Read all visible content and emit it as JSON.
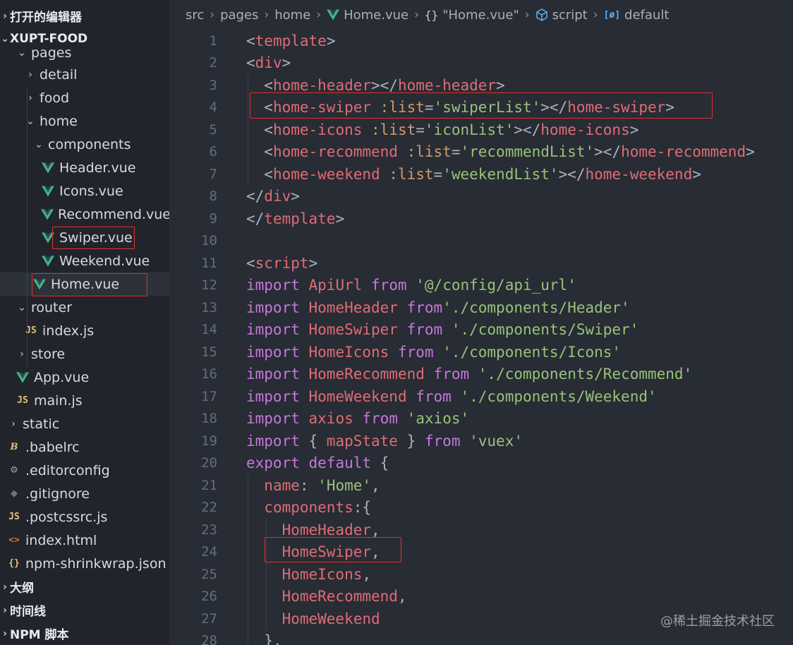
{
  "sidebar": {
    "open_editors_label": "打开的编辑器",
    "project_label": "XUPT-FOOD",
    "tree": [
      {
        "label": "pages",
        "type": "folder",
        "open": true
      },
      {
        "label": "detail",
        "type": "folder",
        "open": false
      },
      {
        "label": "food",
        "type": "folder",
        "open": false
      },
      {
        "label": "home",
        "type": "folder",
        "open": true
      },
      {
        "label": "components",
        "type": "folder",
        "open": true
      },
      {
        "label": "Header.vue",
        "type": "vue"
      },
      {
        "label": "Icons.vue",
        "type": "vue"
      },
      {
        "label": "Recommend.vue",
        "type": "vue"
      },
      {
        "label": "Swiper.vue",
        "type": "vue"
      },
      {
        "label": "Weekend.vue",
        "type": "vue"
      },
      {
        "label": "Home.vue",
        "type": "vue",
        "selected": true
      },
      {
        "label": "router",
        "type": "folder",
        "open": true
      },
      {
        "label": "index.js",
        "type": "js"
      },
      {
        "label": "store",
        "type": "folder",
        "open": false
      },
      {
        "label": "App.vue",
        "type": "vue"
      },
      {
        "label": "main.js",
        "type": "js"
      },
      {
        "label": "static",
        "type": "folder",
        "open": false
      },
      {
        "label": ".babelrc",
        "type": "babel"
      },
      {
        "label": ".editorconfig",
        "type": "config"
      },
      {
        "label": ".gitignore",
        "type": "git"
      },
      {
        "label": ".postcssrc.js",
        "type": "js"
      },
      {
        "label": "index.html",
        "type": "html"
      },
      {
        "label": "npm-shrinkwrap.json",
        "type": "json"
      }
    ],
    "outline_label": "大纲",
    "timeline_label": "时间线",
    "npm_scripts_label": "NPM 脚本"
  },
  "breadcrumb": {
    "items": [
      "src",
      "pages",
      "home",
      "Home.vue",
      "\"Home.vue\"",
      "script",
      "default"
    ]
  },
  "editor": {
    "lines": [
      {
        "n": "1",
        "tokens": [
          [
            "p",
            "<"
          ],
          [
            "tag",
            "template"
          ],
          [
            "p",
            ">"
          ]
        ]
      },
      {
        "n": "2",
        "tokens": [
          [
            "p",
            "<"
          ],
          [
            "tag",
            "div"
          ],
          [
            "p",
            ">"
          ]
        ]
      },
      {
        "n": "3",
        "tokens": [
          [
            "p",
            "  <"
          ],
          [
            "tag",
            "home-header"
          ],
          [
            "p",
            "></"
          ],
          [
            "tag",
            "home-header"
          ],
          [
            "p",
            ">"
          ]
        ]
      },
      {
        "n": "4",
        "tokens": [
          [
            "p",
            "  <"
          ],
          [
            "tag",
            "home-swiper"
          ],
          [
            "p",
            " "
          ],
          [
            "attr",
            ":list"
          ],
          [
            "p",
            "="
          ],
          [
            "str",
            "'swiperList'"
          ],
          [
            "p",
            "></"
          ],
          [
            "tag",
            "home-swiper"
          ],
          [
            "p",
            ">"
          ]
        ]
      },
      {
        "n": "5",
        "tokens": [
          [
            "p",
            "  <"
          ],
          [
            "tag",
            "home-icons"
          ],
          [
            "p",
            " "
          ],
          [
            "attr",
            ":list"
          ],
          [
            "p",
            "="
          ],
          [
            "str",
            "'iconList'"
          ],
          [
            "p",
            "></"
          ],
          [
            "tag",
            "home-icons"
          ],
          [
            "p",
            ">"
          ]
        ]
      },
      {
        "n": "6",
        "tokens": [
          [
            "p",
            "  <"
          ],
          [
            "tag",
            "home-recommend"
          ],
          [
            "p",
            " "
          ],
          [
            "attr",
            ":list"
          ],
          [
            "p",
            "="
          ],
          [
            "str",
            "'recommendList'"
          ],
          [
            "p",
            "></"
          ],
          [
            "tag",
            "home-recommend"
          ],
          [
            "p",
            ">"
          ]
        ]
      },
      {
        "n": "7",
        "tokens": [
          [
            "p",
            "  <"
          ],
          [
            "tag",
            "home-weekend"
          ],
          [
            "p",
            " "
          ],
          [
            "attr",
            ":list"
          ],
          [
            "p",
            "="
          ],
          [
            "str",
            "'weekendList'"
          ],
          [
            "p",
            "></"
          ],
          [
            "tag",
            "home-weekend"
          ],
          [
            "p",
            ">"
          ]
        ]
      },
      {
        "n": "8",
        "tokens": [
          [
            "p",
            "</"
          ],
          [
            "tag",
            "div"
          ],
          [
            "p",
            ">"
          ]
        ]
      },
      {
        "n": "9",
        "tokens": [
          [
            "p",
            "</"
          ],
          [
            "tag",
            "template"
          ],
          [
            "p",
            ">"
          ]
        ]
      },
      {
        "n": "10",
        "tokens": []
      },
      {
        "n": "11",
        "tokens": [
          [
            "p",
            "<"
          ],
          [
            "tag",
            "script"
          ],
          [
            "p",
            ">"
          ]
        ]
      },
      {
        "n": "12",
        "tokens": [
          [
            "kw",
            "import"
          ],
          [
            "p",
            " "
          ],
          [
            "id",
            "ApiUrl"
          ],
          [
            "p",
            " "
          ],
          [
            "kw",
            "from"
          ],
          [
            "p",
            " "
          ],
          [
            "str",
            "'@/config/api_url'"
          ]
        ]
      },
      {
        "n": "13",
        "tokens": [
          [
            "kw",
            "import"
          ],
          [
            "p",
            " "
          ],
          [
            "id",
            "HomeHeader"
          ],
          [
            "p",
            " "
          ],
          [
            "kw",
            "from"
          ],
          [
            "str",
            "'./components/Header'"
          ]
        ]
      },
      {
        "n": "14",
        "tokens": [
          [
            "kw",
            "import"
          ],
          [
            "p",
            " "
          ],
          [
            "id",
            "HomeSwiper"
          ],
          [
            "p",
            " "
          ],
          [
            "kw",
            "from"
          ],
          [
            "p",
            " "
          ],
          [
            "str",
            "'./components/Swiper'"
          ]
        ]
      },
      {
        "n": "15",
        "tokens": [
          [
            "kw",
            "import"
          ],
          [
            "p",
            " "
          ],
          [
            "id",
            "HomeIcons"
          ],
          [
            "p",
            " "
          ],
          [
            "kw",
            "from"
          ],
          [
            "p",
            " "
          ],
          [
            "str",
            "'./components/Icons'"
          ]
        ]
      },
      {
        "n": "16",
        "tokens": [
          [
            "kw",
            "import"
          ],
          [
            "p",
            " "
          ],
          [
            "id",
            "HomeRecommend"
          ],
          [
            "p",
            " "
          ],
          [
            "kw",
            "from"
          ],
          [
            "p",
            " "
          ],
          [
            "str",
            "'./components/Recommend'"
          ]
        ]
      },
      {
        "n": "17",
        "tokens": [
          [
            "kw",
            "import"
          ],
          [
            "p",
            " "
          ],
          [
            "id",
            "HomeWeekend"
          ],
          [
            "p",
            " "
          ],
          [
            "kw",
            "from"
          ],
          [
            "p",
            " "
          ],
          [
            "str",
            "'./components/Weekend'"
          ]
        ]
      },
      {
        "n": "18",
        "tokens": [
          [
            "kw",
            "import"
          ],
          [
            "p",
            " "
          ],
          [
            "id",
            "axios"
          ],
          [
            "p",
            " "
          ],
          [
            "kw",
            "from"
          ],
          [
            "p",
            " "
          ],
          [
            "str",
            "'axios'"
          ]
        ]
      },
      {
        "n": "19",
        "tokens": [
          [
            "kw",
            "import"
          ],
          [
            "p",
            " { "
          ],
          [
            "id",
            "mapState"
          ],
          [
            "p",
            " } "
          ],
          [
            "kw",
            "from"
          ],
          [
            "p",
            " "
          ],
          [
            "str",
            "'vuex'"
          ]
        ]
      },
      {
        "n": "20",
        "tokens": [
          [
            "kw",
            "export"
          ],
          [
            "p",
            " "
          ],
          [
            "kw",
            "default"
          ],
          [
            "p",
            " {"
          ]
        ]
      },
      {
        "n": "21",
        "tokens": [
          [
            "p",
            "  "
          ],
          [
            "id",
            "name"
          ],
          [
            "p",
            ": "
          ],
          [
            "str",
            "'Home'"
          ],
          [
            "p",
            ","
          ]
        ]
      },
      {
        "n": "22",
        "tokens": [
          [
            "p",
            "  "
          ],
          [
            "id",
            "components"
          ],
          [
            "p",
            ":{"
          ]
        ]
      },
      {
        "n": "23",
        "tokens": [
          [
            "p",
            "    "
          ],
          [
            "id",
            "HomeHeader"
          ],
          [
            "p",
            ","
          ]
        ]
      },
      {
        "n": "24",
        "tokens": [
          [
            "p",
            "    "
          ],
          [
            "id",
            "HomeSwiper"
          ],
          [
            "p",
            ","
          ]
        ]
      },
      {
        "n": "25",
        "tokens": [
          [
            "p",
            "    "
          ],
          [
            "id",
            "HomeIcons"
          ],
          [
            "p",
            ","
          ]
        ]
      },
      {
        "n": "26",
        "tokens": [
          [
            "p",
            "    "
          ],
          [
            "id",
            "HomeRecommend"
          ],
          [
            "p",
            ","
          ]
        ]
      },
      {
        "n": "27",
        "tokens": [
          [
            "p",
            "    "
          ],
          [
            "id",
            "HomeWeekend"
          ]
        ]
      },
      {
        "n": "28",
        "tokens": [
          [
            "p",
            "  },"
          ]
        ]
      }
    ]
  },
  "watermark": "@稀土掘金技术社区",
  "colors": {
    "editor_bg": "#282c34",
    "sidebar_bg": "#21252b",
    "highlight_box": "#e03030",
    "tag": "#e06c75",
    "string": "#98c379",
    "keyword": "#c678dd",
    "attribute": "#d19a66"
  }
}
